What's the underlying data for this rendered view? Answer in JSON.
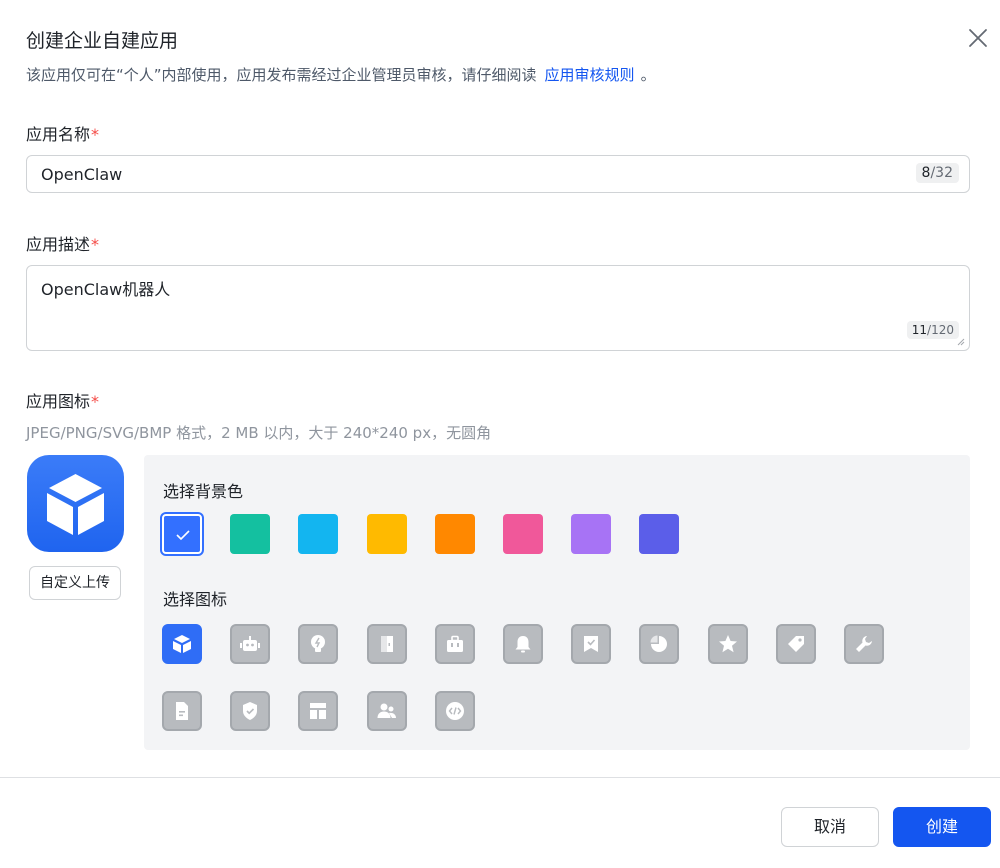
{
  "dialog": {
    "title": "创建企业自建应用",
    "subtitle_prefix": "该应用仅可在“个人”内部使用，应用发布需经过企业管理员审核，请仔细阅读",
    "subtitle_link": "应用审核规则",
    "subtitle_suffix": "。"
  },
  "name_field": {
    "label": "应用名称",
    "required_mark": "*",
    "value": "OpenClaw",
    "count": "8",
    "max": "/32"
  },
  "desc_field": {
    "label": "应用描述",
    "required_mark": "*",
    "value": "OpenClaw机器人",
    "count": "11",
    "max": "/120"
  },
  "icon_field": {
    "label": "应用图标",
    "required_mark": "*",
    "hint": "JPEG/PNG/SVG/BMP 格式，2 MB 以内，大于 240*240 px，无圆角",
    "preview_icon": "cube-icon",
    "upload_label": "自定义上传",
    "bg_label": "选择背景色",
    "bg_colors": [
      "#3370ff",
      "#14c0a0",
      "#13b5f0",
      "#ffba00",
      "#ff8800",
      "#f0589a",
      "#a773f5",
      "#5b5ee9"
    ],
    "selected_bg": 0,
    "icon_label": "选择图标",
    "icons_row1": [
      "cube-icon",
      "robot-icon",
      "lightbulb-icon",
      "door-icon",
      "briefcase-icon",
      "bell-icon",
      "bookmark-check-icon",
      "pie-chart-icon",
      "star-icon",
      "tag-icon",
      "wrench-icon"
    ],
    "icons_row2": [
      "document-icon",
      "shield-check-icon",
      "layout-icon",
      "users-icon",
      "code-icon"
    ],
    "selected_icon": 0
  },
  "footer": {
    "cancel_label": "取消",
    "create_label": "创建"
  }
}
